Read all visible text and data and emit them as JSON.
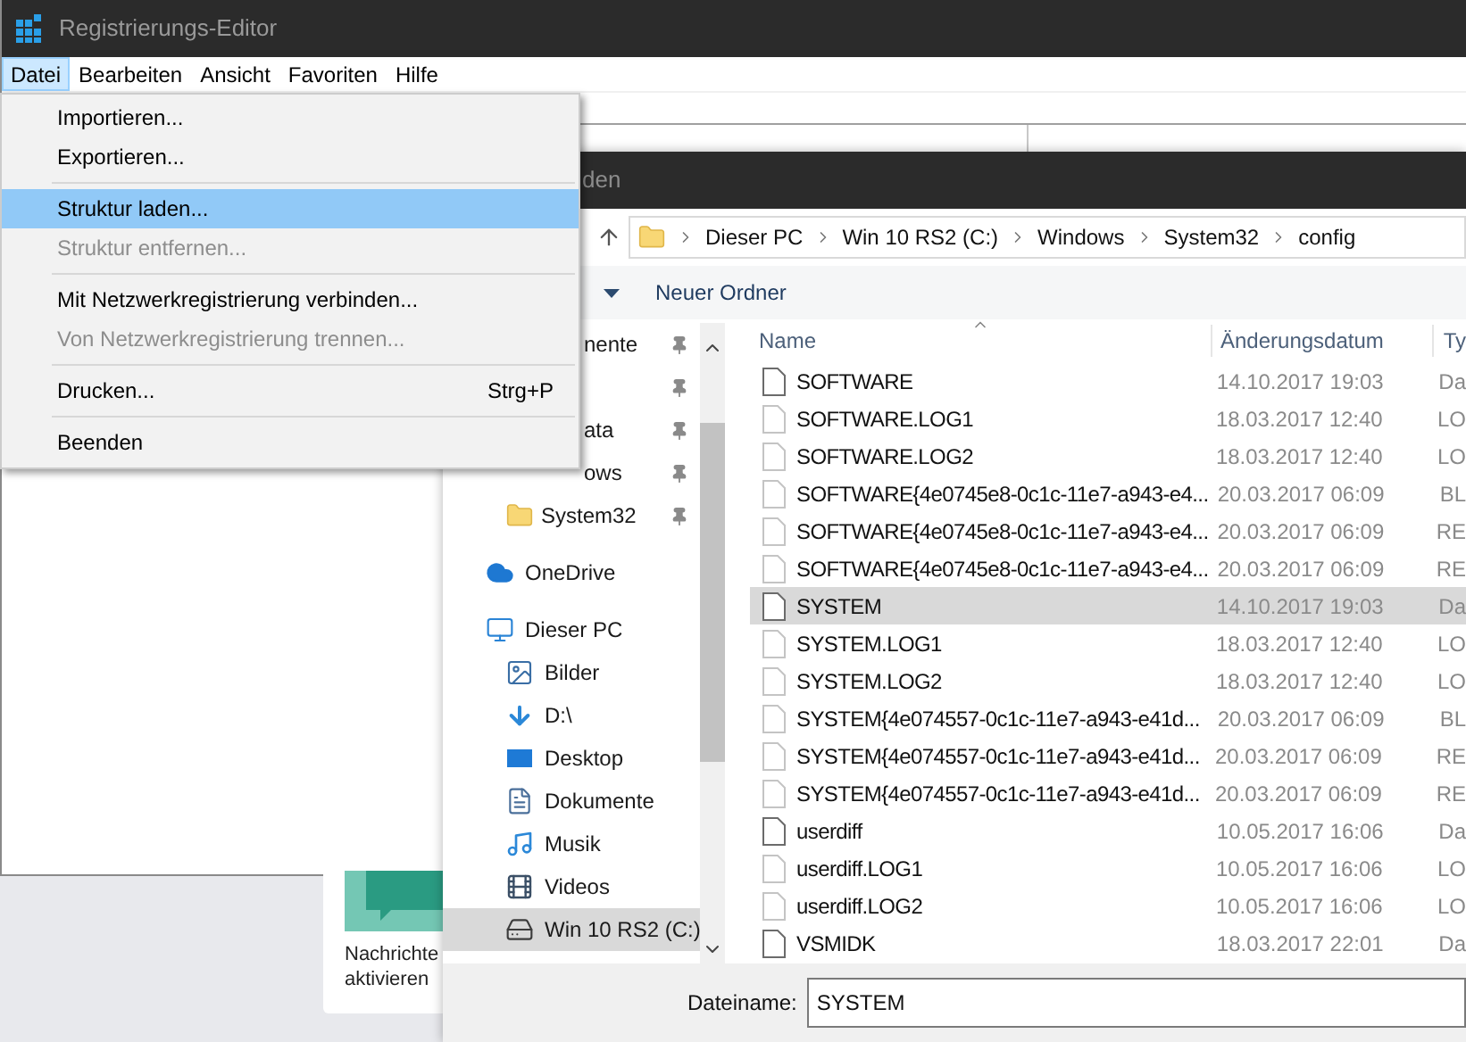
{
  "regedit": {
    "title": "Registrierungs-Editor",
    "menubar": [
      {
        "label": "Datei",
        "selected": true
      },
      {
        "label": "Bearbeiten",
        "selected": false
      },
      {
        "label": "Ansicht",
        "selected": false
      },
      {
        "label": "Favoriten",
        "selected": false
      },
      {
        "label": "Hilfe",
        "selected": false
      }
    ]
  },
  "menu": {
    "items": [
      {
        "kind": "item",
        "label": "Importieren...",
        "disabled": false,
        "selected": false
      },
      {
        "kind": "item",
        "label": "Exportieren...",
        "disabled": false,
        "selected": false
      },
      {
        "kind": "separator"
      },
      {
        "kind": "item",
        "label": "Struktur laden...",
        "disabled": false,
        "selected": true
      },
      {
        "kind": "item",
        "label": "Struktur entfernen...",
        "disabled": true,
        "selected": false
      },
      {
        "kind": "separator"
      },
      {
        "kind": "item",
        "label": "Mit Netzwerkregistrierung verbinden...",
        "disabled": false,
        "selected": false
      },
      {
        "kind": "item",
        "label": "Von Netzwerkregistrierung trennen...",
        "disabled": true,
        "selected": false
      },
      {
        "kind": "separator"
      },
      {
        "kind": "item",
        "label": "Drucken...",
        "shortcut": "Strg+P",
        "disabled": false,
        "selected": false
      },
      {
        "kind": "separator"
      },
      {
        "kind": "item",
        "label": "Beenden",
        "disabled": false,
        "selected": false
      }
    ]
  },
  "background_card": {
    "label": "Nachrichte aktivieren"
  },
  "dialog": {
    "title": "den",
    "breadcrumb": [
      "Dieser PC",
      "Win 10 RS2 (C:)",
      "Windows",
      "System32",
      "config"
    ],
    "toolbar": {
      "new_folder": "Neuer Ordner"
    },
    "nav": {
      "quick_access": [
        {
          "label": "nente",
          "pinned": true
        },
        {
          "pinned": true
        },
        {
          "label": "ata",
          "pinned": true
        },
        {
          "label": "ows",
          "pinned": true
        },
        {
          "label": "System32",
          "pinned": true,
          "kind": "folder"
        }
      ],
      "items": [
        {
          "label": "OneDrive",
          "kind": "cloud",
          "selected": false
        },
        {
          "label": "Dieser PC",
          "kind": "pc",
          "selected": false,
          "children": [
            {
              "label": "Bilder",
              "kind": "pictures",
              "selected": false
            },
            {
              "label": "D:\\",
              "kind": "download",
              "selected": false
            },
            {
              "label": "Desktop",
              "kind": "desktop",
              "selected": false
            },
            {
              "label": "Dokumente",
              "kind": "documents",
              "selected": false
            },
            {
              "label": "Musik",
              "kind": "music",
              "selected": false
            },
            {
              "label": "Videos",
              "kind": "videos",
              "selected": false
            },
            {
              "label": "Win 10 RS2 (C:)",
              "kind": "drive",
              "selected": true
            }
          ]
        }
      ]
    },
    "columns": [
      "Name",
      "Änderungsdatum",
      "Ty"
    ],
    "files": [
      {
        "name": "SOFTWARE",
        "date": "14.10.2017 19:03",
        "type": "Da",
        "kind": "data",
        "selected": false
      },
      {
        "name": "SOFTWARE.LOG1",
        "date": "18.03.2017 12:40",
        "type": "LO",
        "kind": "other",
        "selected": false
      },
      {
        "name": "SOFTWARE.LOG2",
        "date": "18.03.2017 12:40",
        "type": "LO",
        "kind": "other",
        "selected": false
      },
      {
        "name": "SOFTWARE{4e0745e8-0c1c-11e7-a943-e4...",
        "date": "20.03.2017 06:09",
        "type": "BL",
        "kind": "other",
        "selected": false
      },
      {
        "name": "SOFTWARE{4e0745e8-0c1c-11e7-a943-e4...",
        "date": "20.03.2017 06:09",
        "type": "RE",
        "kind": "other",
        "selected": false
      },
      {
        "name": "SOFTWARE{4e0745e8-0c1c-11e7-a943-e4...",
        "date": "20.03.2017 06:09",
        "type": "RE",
        "kind": "other",
        "selected": false
      },
      {
        "name": "SYSTEM",
        "date": "14.10.2017 19:03",
        "type": "Da",
        "kind": "data",
        "selected": true
      },
      {
        "name": "SYSTEM.LOG1",
        "date": "18.03.2017 12:40",
        "type": "LO",
        "kind": "other",
        "selected": false
      },
      {
        "name": "SYSTEM.LOG2",
        "date": "18.03.2017 12:40",
        "type": "LO",
        "kind": "other",
        "selected": false
      },
      {
        "name": "SYSTEM{4e074557-0c1c-11e7-a943-e41d...",
        "date": "20.03.2017 06:09",
        "type": "BL",
        "kind": "other",
        "selected": false
      },
      {
        "name": "SYSTEM{4e074557-0c1c-11e7-a943-e41d...",
        "date": "20.03.2017 06:09",
        "type": "RE",
        "kind": "other",
        "selected": false
      },
      {
        "name": "SYSTEM{4e074557-0c1c-11e7-a943-e41d...",
        "date": "20.03.2017 06:09",
        "type": "RE",
        "kind": "other",
        "selected": false
      },
      {
        "name": "userdiff",
        "date": "10.05.2017 16:06",
        "type": "Da",
        "kind": "data",
        "selected": false
      },
      {
        "name": "userdiff.LOG1",
        "date": "10.05.2017 16:06",
        "type": "LO",
        "kind": "other",
        "selected": false
      },
      {
        "name": "userdiff.LOG2",
        "date": "10.05.2017 16:06",
        "type": "LO",
        "kind": "other",
        "selected": false
      },
      {
        "name": "VSMIDK",
        "date": "18.03.2017 22:01",
        "type": "Da",
        "kind": "data",
        "selected": false
      }
    ],
    "filename": {
      "label": "Dateiname:",
      "value": "SYSTEM"
    }
  }
}
